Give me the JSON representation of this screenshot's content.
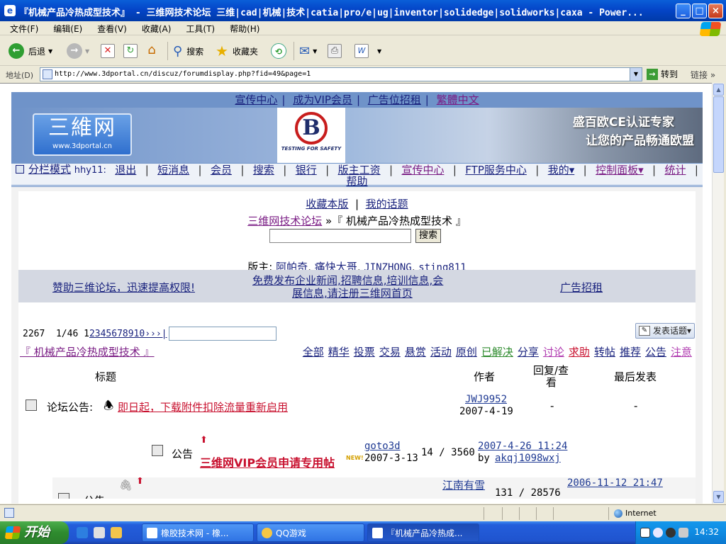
{
  "window": {
    "title": "『机械产品冷热成型技术』 - 三维网技术论坛 三维|cad|机械|技术|catia|pro/e|ug|inventor|solidedge|solidworks|caxa - Power..."
  },
  "menu": [
    "文件(F)",
    "编辑(E)",
    "查看(V)",
    "收藏(A)",
    "工具(T)",
    "帮助(H)"
  ],
  "toolbar": {
    "back": "后退",
    "search": "搜索",
    "favorites": "收藏夹"
  },
  "address": {
    "label": "地址(D)",
    "url": "http://www.3dportal.cn/discuz/forumdisplay.php?fid=49&page=1",
    "go": "转到",
    "links": "链接"
  },
  "topnav": [
    "宣传中心",
    "成为VIP会员",
    "广告位招租",
    "繁體中文"
  ],
  "banner": {
    "logo_text": "三維网",
    "logo_url": "www.3dportal.cn",
    "ad_caption": "TESTING FOR SAFETY",
    "ad_line1": "盛百欧CE认证专家",
    "ad_line2": "让您的产品畅通欧盟"
  },
  "usernav": {
    "mode": "分栏模式",
    "username": "hhy11:",
    "items": [
      "退出",
      "短消息",
      "会员",
      "搜索",
      "银行",
      "版主工资",
      "宣传中心",
      "FTP服务中心",
      "我的▾",
      "控制面板▾",
      "统计"
    ],
    "help": "帮助"
  },
  "forum": {
    "fav": "收藏本版",
    "mytopics": "我的话题",
    "crumb_root": "三维网技术论坛",
    "crumb_sep": "»",
    "crumb_current": "『 机械产品冷热成型技术 』",
    "search_btn": "搜索",
    "moderators_label": "版主:",
    "moderators": [
      "阿帕奇",
      "痛快大哥",
      "JINZHONG",
      "sting811"
    ],
    "promo_left": "赞助三维论坛，迅速提高权限!",
    "promo_mid_1": "免费发布企业新闻,招聘信息,培训信息,会",
    "promo_mid_2": "展信息,请注册三维网首页",
    "promo_right": "广告招租",
    "total": "2267",
    "page_info": "1/46",
    "page_current": "1",
    "page_links": "2345678910›››|",
    "post_btn": "发表话题",
    "name_link": "『 机械产品冷热成型技术 』",
    "filters": [
      {
        "label": "全部",
        "color": "#1a237e"
      },
      {
        "label": "精华",
        "color": "#1a237e"
      },
      {
        "label": "投票",
        "color": "#1a237e"
      },
      {
        "label": "交易",
        "color": "#1a237e"
      },
      {
        "label": "悬赏",
        "color": "#1a237e"
      },
      {
        "label": "活动",
        "color": "#1a237e"
      },
      {
        "label": "原创",
        "color": "#1a237e"
      },
      {
        "label": "已解决",
        "color": "#2e8b2e"
      },
      {
        "label": "分享",
        "color": "#1a237e"
      },
      {
        "label": "讨论",
        "color": "#b03bb0"
      },
      {
        "label": "求助",
        "color": "#c8102e"
      },
      {
        "label": "转帖",
        "color": "#1a237e"
      },
      {
        "label": "推荐",
        "color": "#1a237e"
      },
      {
        "label": "公告",
        "color": "#1a237e"
      },
      {
        "label": "注意",
        "color": "#b03bb0"
      }
    ],
    "col_title": "标题",
    "col_author": "作者",
    "col_replies_1": "回复/查",
    "col_replies_2": "看",
    "col_last": "最后发表"
  },
  "rows": [
    {
      "prefix": "论坛公告:",
      "title": "即日起，下载附件扣除流量重新启用",
      "author": "JWJ9952",
      "date": "2007-4-19",
      "replies": "-",
      "last": "-"
    },
    {
      "prefix": "公告",
      "title": "三维网VIP会员申请专用帖",
      "new_tag": "NEW!",
      "author": "goto3d",
      "date": "2007-3-13",
      "replies": "14 / 3560",
      "last_time": "2007-4-26 11:24",
      "last_by": "by",
      "last_user": "akqj1098wxj"
    },
    {
      "prefix": "公告",
      "author": "江南有雪",
      "replies": "131 / 28576",
      "last_time": "2006-11-12 21:47"
    }
  ],
  "status": {
    "zone": "Internet"
  },
  "taskbar": {
    "start": "开始",
    "tasks": [
      "橡胶技术网 - 橡...",
      "QQ游戏",
      "『机械产品冷热成..."
    ],
    "clock": "14:32"
  }
}
